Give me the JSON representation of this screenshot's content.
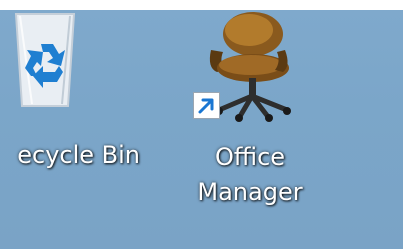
{
  "desktop": {
    "background_color": "#7ba6c9",
    "icons": [
      {
        "label": "ecycle Bin",
        "icon": "recycle-bin-icon"
      },
      {
        "label_line1": "Office",
        "label_line2": "Manager",
        "icon": "office-chair-icon",
        "overlay": "shortcut-arrow-icon"
      }
    ]
  }
}
